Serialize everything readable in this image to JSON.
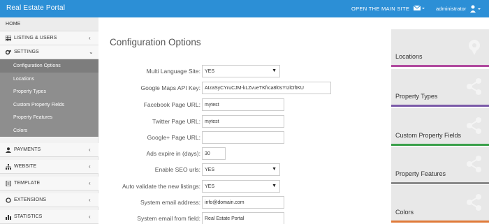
{
  "topbar": {
    "brand": "Real Estate Portal",
    "main_site_link": "OPEN THE MAIN SITE",
    "username": "administrator"
  },
  "sidebar": {
    "home": "HOME",
    "listing": "LISTING & USERS",
    "settings": "SETTINGS",
    "settings_sub": [
      "Configuration Options",
      "Locations",
      "Property Types",
      "Custom Property Fields",
      "Property Features",
      "Colors"
    ],
    "payments": "PAYMENTS",
    "website": "WEBSITE",
    "template": "TEMPLATE",
    "extensions": "EXTENSIONS",
    "statistics": "STATISTICS"
  },
  "main": {
    "title": "Configuration Options",
    "fields": [
      {
        "label": "Multi Language Site:",
        "value": "YES",
        "type": "select"
      },
      {
        "label": "Google Maps API Key:",
        "value": "AIzaSyCYruCJM-kLZvueTKfrca8l0sYIzlOftKU",
        "type": "text"
      },
      {
        "label": "Facebook Page URL:",
        "value": "mytest",
        "type": "text"
      },
      {
        "label": "Twitter Page URL:",
        "value": "mytest",
        "type": "text"
      },
      {
        "label": "Google+ Page URL:",
        "value": "",
        "type": "text"
      },
      {
        "label": "Ads expire in (days):",
        "value": "30",
        "type": "text"
      },
      {
        "label": "Enable SEO urls:",
        "value": "YES",
        "type": "select"
      },
      {
        "label": "Auto validate the new listings:",
        "value": "YES",
        "type": "select"
      },
      {
        "label": "System email address:",
        "value": "info@domain.com",
        "type": "text"
      },
      {
        "label": "System email from field:",
        "value": "Real Estate Portal",
        "type": "text"
      }
    ]
  },
  "panels": [
    {
      "title": "Locations",
      "color": "#b04a9e"
    },
    {
      "title": "Property Types",
      "color": "#7b5aa8"
    },
    {
      "title": "Custom Property Fields",
      "color": "#3aa04a"
    },
    {
      "title": "Property Features",
      "color": "#888888"
    },
    {
      "title": "Colors",
      "color": "#e07a3a"
    }
  ],
  "colors": {
    "topbar": "#2c8fd6",
    "sub_menu": "#8e8e8e"
  }
}
